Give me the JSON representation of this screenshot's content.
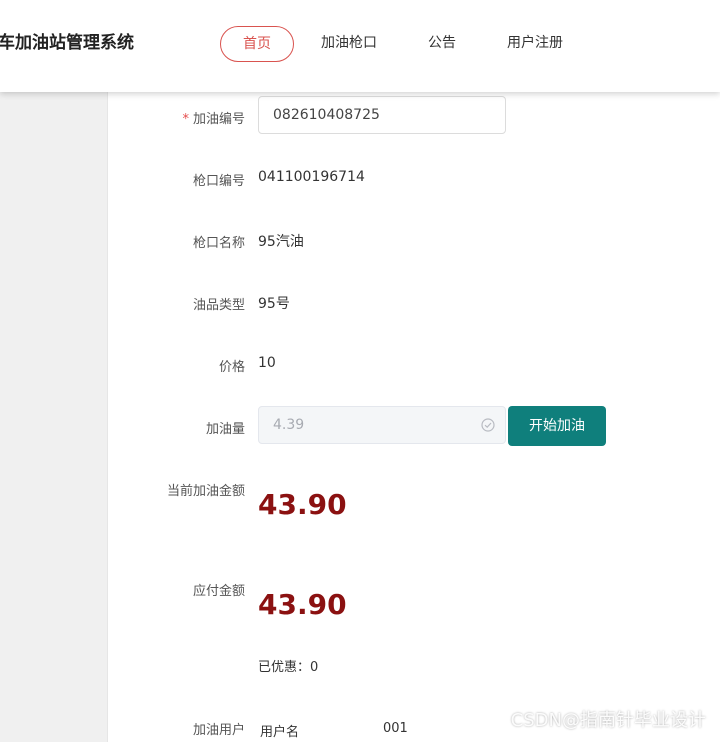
{
  "header": {
    "site_title": "车加油站管理系统",
    "nav": [
      "首页",
      "加油枪口",
      "公告",
      "用户注册"
    ]
  },
  "form": {
    "fuel_no": {
      "label": "加油编号",
      "value": "082610408725"
    },
    "nozzle_no": {
      "label": "枪口编号",
      "value": "041100196714"
    },
    "nozzle_name": {
      "label": "枪口名称",
      "value": "95汽油"
    },
    "oil_type": {
      "label": "油品类型",
      "value": "95号"
    },
    "price": {
      "label": "价格",
      "value": "10"
    },
    "fuel_amount": {
      "label": "加油量",
      "value": "4.39"
    },
    "start_button": "开始加油",
    "current_amount": {
      "label": "当前加油金额",
      "value": "43.90"
    },
    "payable": {
      "label": "应付金额",
      "value": "43.90"
    },
    "discount": "已优惠：0",
    "fuel_user": {
      "label": "加油用户",
      "field": "用户名",
      "value": "001"
    }
  },
  "watermark": "CSDN@指南针毕业设计"
}
